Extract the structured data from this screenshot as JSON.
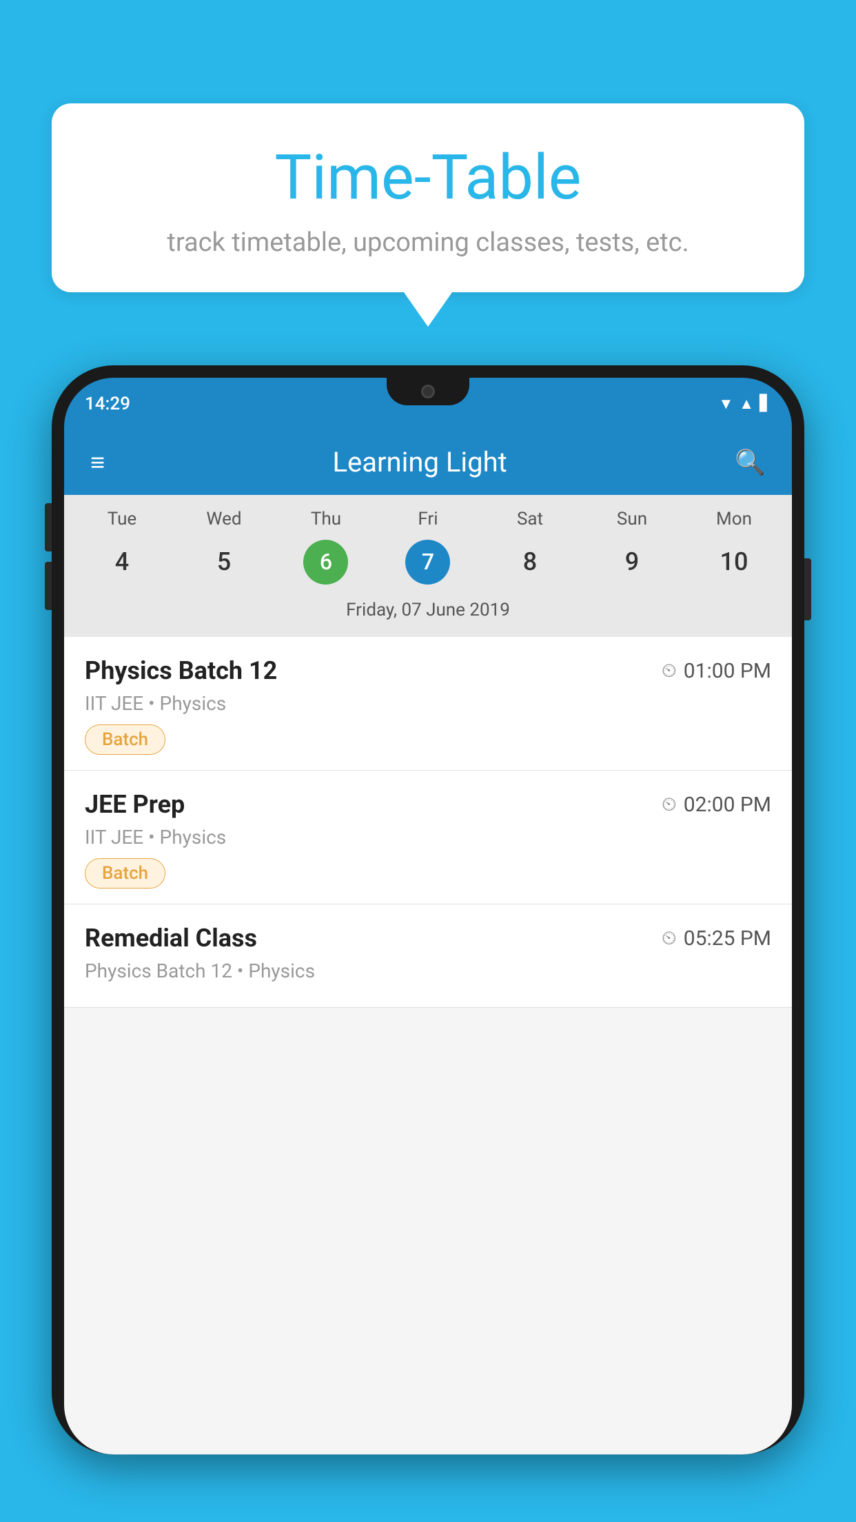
{
  "background_color": "#29B6E8",
  "speech_bubble": {
    "title": "Time-Table",
    "subtitle": "track timetable, upcoming classes, tests, etc."
  },
  "phone": {
    "status_bar": {
      "time": "14:29"
    },
    "app_bar": {
      "title": "Learning Light"
    },
    "calendar": {
      "days": [
        {
          "name": "Tue",
          "number": "4",
          "state": "normal"
        },
        {
          "name": "Wed",
          "number": "5",
          "state": "normal"
        },
        {
          "name": "Thu",
          "number": "6",
          "state": "today"
        },
        {
          "name": "Fri",
          "number": "7",
          "state": "selected"
        },
        {
          "name": "Sat",
          "number": "8",
          "state": "normal"
        },
        {
          "name": "Sun",
          "number": "9",
          "state": "normal"
        },
        {
          "name": "Mon",
          "number": "10",
          "state": "normal"
        }
      ],
      "selected_date_label": "Friday, 07 June 2019"
    },
    "classes": [
      {
        "name": "Physics Batch 12",
        "time": "01:00 PM",
        "meta": "IIT JEE • Physics",
        "tag": "Batch"
      },
      {
        "name": "JEE Prep",
        "time": "02:00 PM",
        "meta": "IIT JEE • Physics",
        "tag": "Batch"
      },
      {
        "name": "Remedial Class",
        "time": "05:25 PM",
        "meta": "Physics Batch 12 • Physics",
        "tag": ""
      }
    ]
  },
  "icons": {
    "hamburger": "≡",
    "search": "🔍",
    "clock": "🕐"
  }
}
